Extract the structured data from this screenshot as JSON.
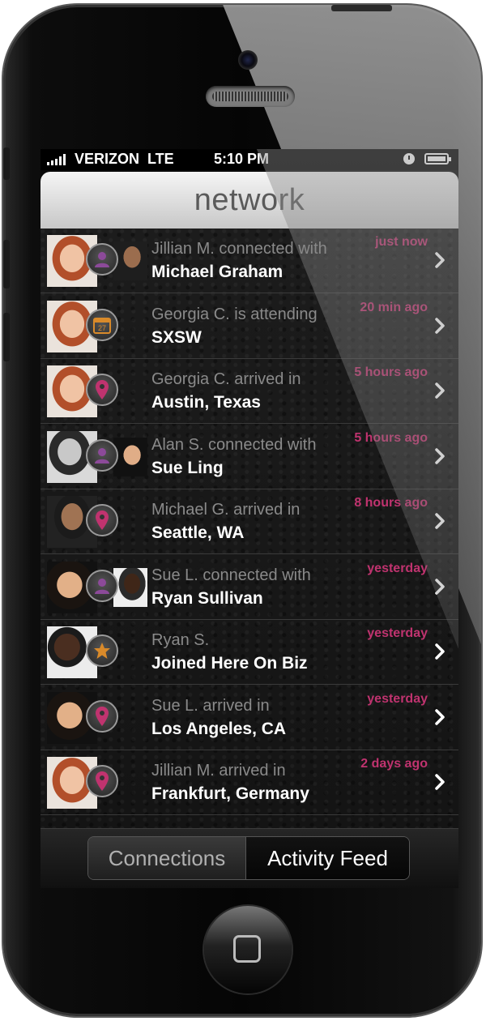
{
  "status": {
    "carrier": "VERIZON  LTE",
    "time": "5:10 PM"
  },
  "nav": {
    "title": "network"
  },
  "colors": {
    "accent": "#c0336f",
    "badge_purple": "#8c4a99",
    "badge_pink": "#c0336f",
    "badge_orange": "#d98a2a"
  },
  "feed": [
    {
      "line1": "Jillian M. connected with",
      "line2": "Michael Graham",
      "time": "just now",
      "icon": "person-icon"
    },
    {
      "line1": "Georgia C. is attending",
      "line2": "SXSW",
      "time": "20 min ago",
      "icon": "calendar-icon",
      "calendar_day": "27"
    },
    {
      "line1": "Georgia C. arrived in",
      "line2": "Austin, Texas",
      "time": "5 hours ago",
      "icon": "location-pin-icon"
    },
    {
      "line1": "Alan S. connected with",
      "line2": "Sue Ling",
      "time": "5 hours ago",
      "icon": "person-icon"
    },
    {
      "line1": "Michael G. arrived in",
      "line2": "Seattle, WA",
      "time": "8 hours ago",
      "icon": "location-pin-icon"
    },
    {
      "line1": "Sue L. connected with",
      "line2": "Ryan Sullivan",
      "time": "yesterday",
      "icon": "person-icon"
    },
    {
      "line1": "Ryan S.",
      "line2": "Joined Here On Biz",
      "time": "yesterday",
      "icon": "star-icon"
    },
    {
      "line1": "Sue L. arrived in",
      "line2": "Los Angeles, CA",
      "time": "yesterday",
      "icon": "location-pin-icon"
    },
    {
      "line1": "Jillian M. arrived in",
      "line2": "Frankfurt, Germany",
      "time": "2 days ago",
      "icon": "location-pin-icon"
    }
  ],
  "tabs": {
    "connections": "Connections",
    "activity_feed": "Activity Feed",
    "selected": "Activity Feed"
  }
}
